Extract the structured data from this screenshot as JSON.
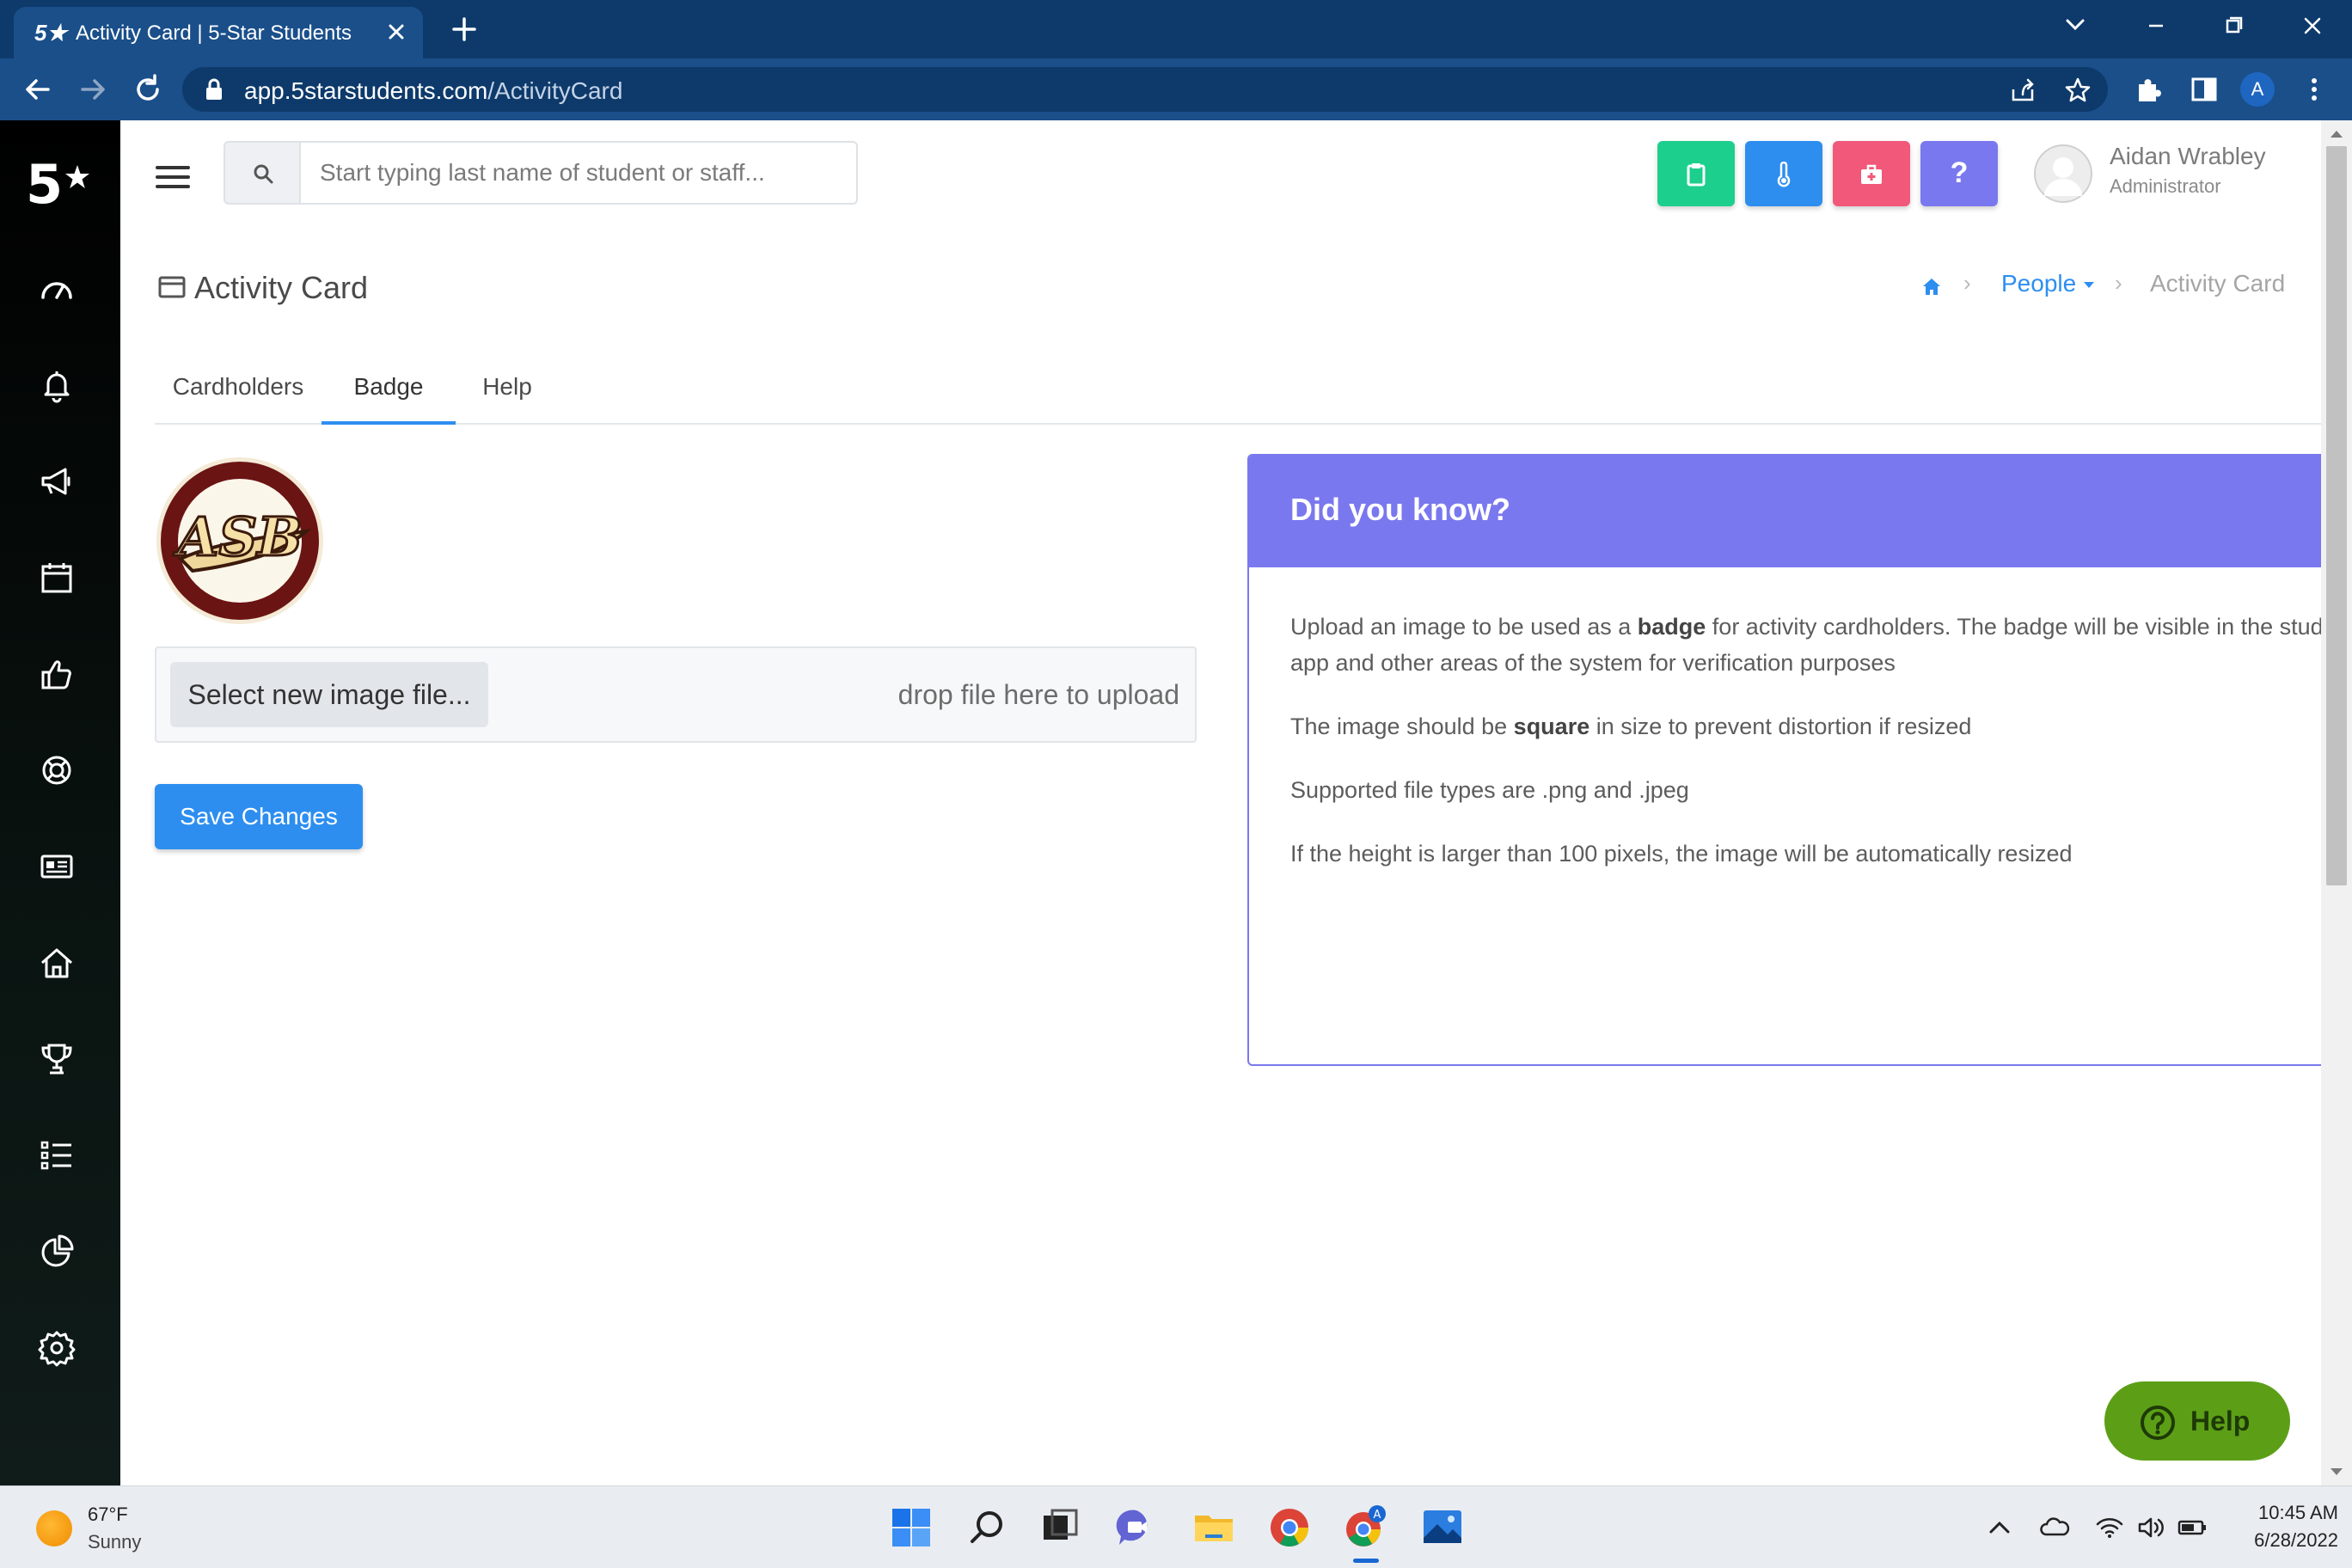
{
  "browser": {
    "tab_title": "Activity Card | 5-Star Students",
    "favicon_text": "5★",
    "url_domain": "app.5starstudents.com",
    "url_path": "/ActivityCard",
    "profile_initial": "A"
  },
  "app": {
    "logo_text": "5",
    "search": {
      "placeholder": "Start typing last name of student or staff..."
    },
    "quick_buttons": [
      {
        "icon": "clipboard-icon",
        "color": "#1ccf8d"
      },
      {
        "icon": "thermometer-icon",
        "color": "#2d8ef0"
      },
      {
        "icon": "first-aid-icon",
        "color": "#f1587a"
      },
      {
        "icon": "question-icon",
        "label": "?",
        "color": "#7a78ee"
      }
    ],
    "user": {
      "name": "Aidan Wrabley",
      "role": "Administrator"
    },
    "sidebar_icons": [
      "speedometer-icon",
      "bell-icon",
      "megaphone-icon",
      "calendar-icon",
      "thumbs-up-icon",
      "lifebuoy-icon",
      "id-card-icon",
      "home-icon",
      "trophy-icon",
      "list-icon",
      "pie-chart-icon",
      "settings-icon"
    ]
  },
  "page": {
    "title": "Activity Card",
    "breadcrumb": {
      "parent": "People",
      "current": "Activity Card"
    },
    "tabs": [
      "Cardholders",
      "Badge",
      "Help"
    ],
    "active_tab": "Badge",
    "badge_logo_text": "ASB",
    "upload": {
      "select_label": "Select new image file...",
      "drop_hint": "drop file here to upload"
    },
    "save_label": "Save Changes"
  },
  "info_card": {
    "title": "Did you know?",
    "p1_before": "Upload an image to be used as a ",
    "p1_bold": "badge",
    "p1_after": " for activity cardholders. The badge will be visible in the student app and other areas of the system for verification purposes",
    "p2_before": "The image should be ",
    "p2_bold": "square",
    "p2_after": " in size to prevent distortion if resized",
    "p3": "Supported file types are .png and .jpeg",
    "p4": "If the height is larger than 100 pixels, the image will be automatically resized"
  },
  "help_button": "Help",
  "taskbar": {
    "weather_temp": "67°F",
    "weather_desc": "Sunny",
    "time": "10:45 AM",
    "date": "6/28/2022",
    "apps": [
      "windows-start-icon",
      "search-icon",
      "task-view-icon",
      "teams-chat-icon",
      "file-explorer-icon",
      "chrome-icon",
      "chrome-profile-icon",
      "photos-icon"
    ]
  }
}
